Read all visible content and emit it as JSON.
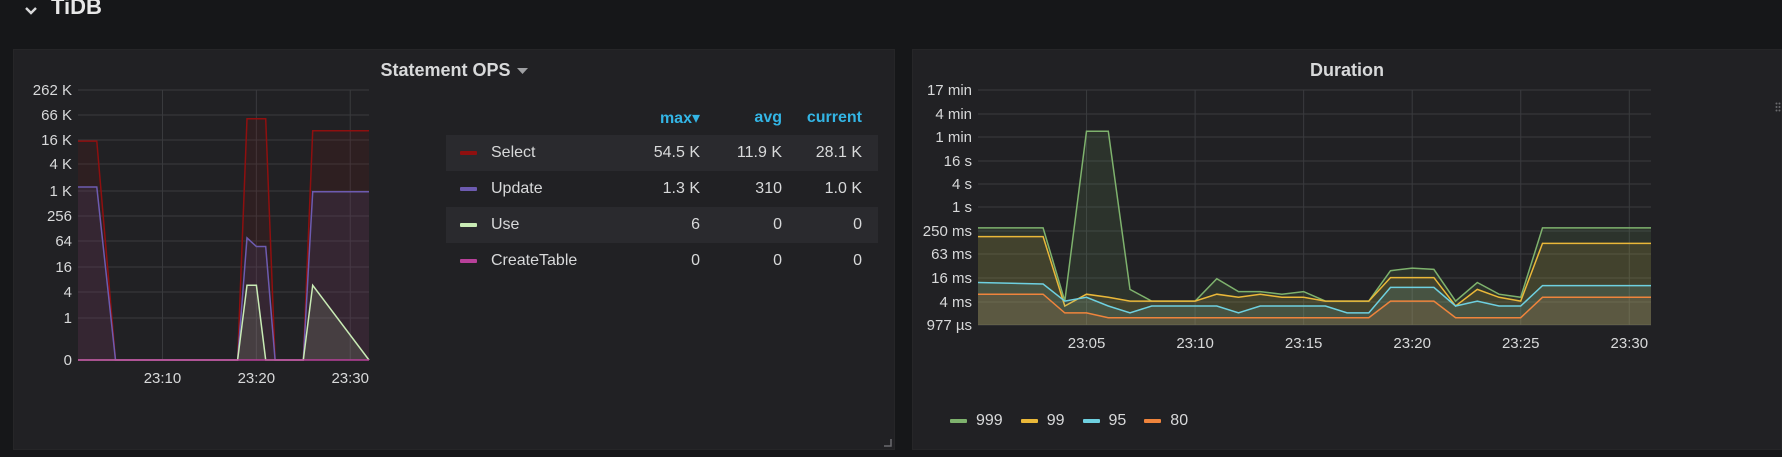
{
  "row": {
    "title": "TiDB"
  },
  "panels": {
    "ops": {
      "title": "Statement OPS",
      "legend": {
        "headers": [
          "max▾",
          "avg",
          "current"
        ],
        "rows": [
          {
            "name": "Select",
            "max": "54.5 K",
            "avg": "11.9 K",
            "current": "28.1 K",
            "color": "#8f0f0f"
          },
          {
            "name": "Update",
            "max": "1.3 K",
            "avg": "310",
            "current": "1.0 K",
            "color": "#6d5bb0"
          },
          {
            "name": "Use",
            "max": "6",
            "avg": "0",
            "current": "0",
            "color": "#c9ebb5"
          },
          {
            "name": "CreateTable",
            "max": "0",
            "avg": "0",
            "current": "0",
            "color": "#b8409a"
          }
        ]
      }
    },
    "duration": {
      "title": "Duration",
      "legend": [
        {
          "name": "999",
          "color": "#7eb26d"
        },
        {
          "name": "99",
          "color": "#eab839"
        },
        {
          "name": "95",
          "color": "#6ed0e0"
        },
        {
          "name": "80",
          "color": "#ef843c"
        }
      ]
    }
  },
  "chart_data": [
    {
      "type": "area",
      "title": "Statement OPS",
      "y_scale": "log",
      "y_tick_labels": [
        "262 K",
        "66 K",
        "16 K",
        "4 K",
        "1 K",
        "256",
        "64",
        "16",
        "4",
        "1",
        "0"
      ],
      "x_tick_labels": [
        "23:10",
        "23:20",
        "23:30"
      ],
      "grid": true,
      "x": [
        "23:01",
        "23:03",
        "23:05",
        "23:18",
        "23:19",
        "23:20",
        "23:21",
        "23:22",
        "23:25",
        "23:26",
        "23:32"
      ],
      "series": [
        {
          "name": "Select",
          "color": "#8f0f0f",
          "values": [
            16000,
            16000,
            0,
            0,
            54500,
            54500,
            54500,
            0,
            0,
            28100,
            28100
          ]
        },
        {
          "name": "Update",
          "color": "#6d5bb0",
          "values": [
            1300,
            1300,
            0,
            0,
            80,
            50,
            50,
            0,
            0,
            1000,
            1000
          ]
        },
        {
          "name": "Use",
          "color": "#c9ebb5",
          "values": [
            0,
            0,
            0,
            0,
            6,
            6,
            0,
            0,
            0,
            6,
            0
          ]
        },
        {
          "name": "CreateTable",
          "color": "#b8409a",
          "values": [
            0,
            0,
            0,
            0,
            0,
            0,
            0,
            0,
            0,
            0,
            0
          ]
        }
      ]
    },
    {
      "type": "area",
      "title": "Duration",
      "y_scale": "log",
      "y_tick_labels": [
        "17 min",
        "4 min",
        "1 min",
        "16 s",
        "4 s",
        "1 s",
        "250 ms",
        "63 ms",
        "16 ms",
        "4 ms",
        "977 µs"
      ],
      "x_tick_labels": [
        "23:05",
        "23:10",
        "23:15",
        "23:20",
        "23:25",
        "23:30"
      ],
      "grid": true,
      "legend_position": "bottom-left",
      "x": [
        "23:00",
        "23:03",
        "23:04",
        "23:05",
        "23:06",
        "23:07",
        "23:08",
        "23:10",
        "23:11",
        "23:12",
        "23:13",
        "23:14",
        "23:15",
        "23:16",
        "23:17",
        "23:18",
        "23:19",
        "23:20",
        "23:21",
        "23:22",
        "23:23",
        "23:24",
        "23:25",
        "23:26",
        "23:30",
        "23:31"
      ],
      "series": [
        {
          "name": "999",
          "values": [
            0.3,
            0.3,
            0.004,
            90,
            90,
            0.008,
            0.004,
            0.004,
            0.015,
            0.007,
            0.007,
            0.006,
            0.007,
            0.004,
            0.004,
            0.004,
            0.024,
            0.028,
            0.026,
            0.004,
            0.012,
            0.006,
            0.005,
            0.3,
            0.3,
            0.3
          ]
        },
        {
          "name": "99",
          "values": [
            0.18,
            0.18,
            0.003,
            0.006,
            0.005,
            0.004,
            0.004,
            0.004,
            0.006,
            0.005,
            0.006,
            0.005,
            0.005,
            0.004,
            0.004,
            0.004,
            0.016,
            0.016,
            0.016,
            0.003,
            0.008,
            0.005,
            0.004,
            0.12,
            0.12,
            0.12
          ]
        },
        {
          "name": "95",
          "values": [
            0.012,
            0.011,
            0.004,
            0.005,
            0.003,
            0.002,
            0.003,
            0.003,
            0.003,
            0.002,
            0.003,
            0.003,
            0.003,
            0.003,
            0.002,
            0.002,
            0.009,
            0.009,
            0.009,
            0.003,
            0.004,
            0.003,
            0.003,
            0.01,
            0.01,
            0.01
          ]
        },
        {
          "name": "80",
          "values": [
            0.006,
            0.006,
            0.002,
            0.002,
            0.0015,
            0.0015,
            0.0015,
            0.0015,
            0.0015,
            0.0015,
            0.0015,
            0.0015,
            0.0015,
            0.0015,
            0.0015,
            0.0015,
            0.004,
            0.004,
            0.004,
            0.0015,
            0.0015,
            0.0015,
            0.0015,
            0.005,
            0.005,
            0.005
          ]
        }
      ]
    }
  ]
}
